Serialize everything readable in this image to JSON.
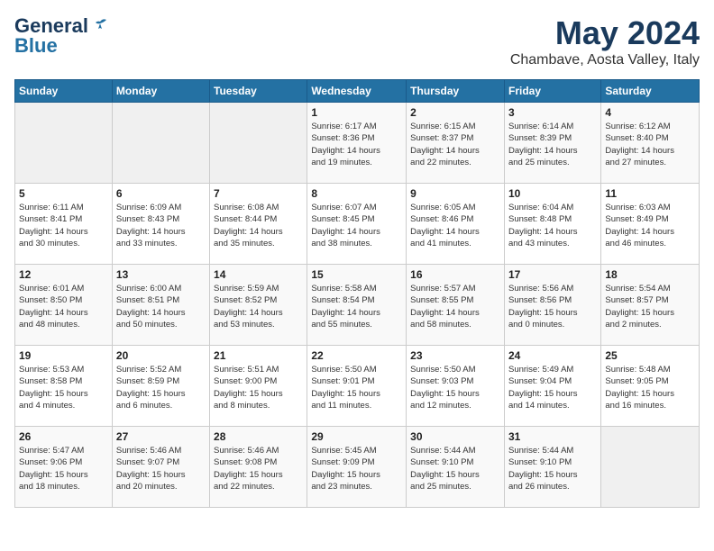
{
  "logo": {
    "line1": "General",
    "line2": "Blue"
  },
  "title": "May 2024",
  "location": "Chambave, Aosta Valley, Italy",
  "days_of_week": [
    "Sunday",
    "Monday",
    "Tuesday",
    "Wednesday",
    "Thursday",
    "Friday",
    "Saturday"
  ],
  "weeks": [
    [
      {
        "day": "",
        "info": ""
      },
      {
        "day": "",
        "info": ""
      },
      {
        "day": "",
        "info": ""
      },
      {
        "day": "1",
        "info": "Sunrise: 6:17 AM\nSunset: 8:36 PM\nDaylight: 14 hours\nand 19 minutes."
      },
      {
        "day": "2",
        "info": "Sunrise: 6:15 AM\nSunset: 8:37 PM\nDaylight: 14 hours\nand 22 minutes."
      },
      {
        "day": "3",
        "info": "Sunrise: 6:14 AM\nSunset: 8:39 PM\nDaylight: 14 hours\nand 25 minutes."
      },
      {
        "day": "4",
        "info": "Sunrise: 6:12 AM\nSunset: 8:40 PM\nDaylight: 14 hours\nand 27 minutes."
      }
    ],
    [
      {
        "day": "5",
        "info": "Sunrise: 6:11 AM\nSunset: 8:41 PM\nDaylight: 14 hours\nand 30 minutes."
      },
      {
        "day": "6",
        "info": "Sunrise: 6:09 AM\nSunset: 8:43 PM\nDaylight: 14 hours\nand 33 minutes."
      },
      {
        "day": "7",
        "info": "Sunrise: 6:08 AM\nSunset: 8:44 PM\nDaylight: 14 hours\nand 35 minutes."
      },
      {
        "day": "8",
        "info": "Sunrise: 6:07 AM\nSunset: 8:45 PM\nDaylight: 14 hours\nand 38 minutes."
      },
      {
        "day": "9",
        "info": "Sunrise: 6:05 AM\nSunset: 8:46 PM\nDaylight: 14 hours\nand 41 minutes."
      },
      {
        "day": "10",
        "info": "Sunrise: 6:04 AM\nSunset: 8:48 PM\nDaylight: 14 hours\nand 43 minutes."
      },
      {
        "day": "11",
        "info": "Sunrise: 6:03 AM\nSunset: 8:49 PM\nDaylight: 14 hours\nand 46 minutes."
      }
    ],
    [
      {
        "day": "12",
        "info": "Sunrise: 6:01 AM\nSunset: 8:50 PM\nDaylight: 14 hours\nand 48 minutes."
      },
      {
        "day": "13",
        "info": "Sunrise: 6:00 AM\nSunset: 8:51 PM\nDaylight: 14 hours\nand 50 minutes."
      },
      {
        "day": "14",
        "info": "Sunrise: 5:59 AM\nSunset: 8:52 PM\nDaylight: 14 hours\nand 53 minutes."
      },
      {
        "day": "15",
        "info": "Sunrise: 5:58 AM\nSunset: 8:54 PM\nDaylight: 14 hours\nand 55 minutes."
      },
      {
        "day": "16",
        "info": "Sunrise: 5:57 AM\nSunset: 8:55 PM\nDaylight: 14 hours\nand 58 minutes."
      },
      {
        "day": "17",
        "info": "Sunrise: 5:56 AM\nSunset: 8:56 PM\nDaylight: 15 hours\nand 0 minutes."
      },
      {
        "day": "18",
        "info": "Sunrise: 5:54 AM\nSunset: 8:57 PM\nDaylight: 15 hours\nand 2 minutes."
      }
    ],
    [
      {
        "day": "19",
        "info": "Sunrise: 5:53 AM\nSunset: 8:58 PM\nDaylight: 15 hours\nand 4 minutes."
      },
      {
        "day": "20",
        "info": "Sunrise: 5:52 AM\nSunset: 8:59 PM\nDaylight: 15 hours\nand 6 minutes."
      },
      {
        "day": "21",
        "info": "Sunrise: 5:51 AM\nSunset: 9:00 PM\nDaylight: 15 hours\nand 8 minutes."
      },
      {
        "day": "22",
        "info": "Sunrise: 5:50 AM\nSunset: 9:01 PM\nDaylight: 15 hours\nand 11 minutes."
      },
      {
        "day": "23",
        "info": "Sunrise: 5:50 AM\nSunset: 9:03 PM\nDaylight: 15 hours\nand 12 minutes."
      },
      {
        "day": "24",
        "info": "Sunrise: 5:49 AM\nSunset: 9:04 PM\nDaylight: 15 hours\nand 14 minutes."
      },
      {
        "day": "25",
        "info": "Sunrise: 5:48 AM\nSunset: 9:05 PM\nDaylight: 15 hours\nand 16 minutes."
      }
    ],
    [
      {
        "day": "26",
        "info": "Sunrise: 5:47 AM\nSunset: 9:06 PM\nDaylight: 15 hours\nand 18 minutes."
      },
      {
        "day": "27",
        "info": "Sunrise: 5:46 AM\nSunset: 9:07 PM\nDaylight: 15 hours\nand 20 minutes."
      },
      {
        "day": "28",
        "info": "Sunrise: 5:46 AM\nSunset: 9:08 PM\nDaylight: 15 hours\nand 22 minutes."
      },
      {
        "day": "29",
        "info": "Sunrise: 5:45 AM\nSunset: 9:09 PM\nDaylight: 15 hours\nand 23 minutes."
      },
      {
        "day": "30",
        "info": "Sunrise: 5:44 AM\nSunset: 9:10 PM\nDaylight: 15 hours\nand 25 minutes."
      },
      {
        "day": "31",
        "info": "Sunrise: 5:44 AM\nSunset: 9:10 PM\nDaylight: 15 hours\nand 26 minutes."
      },
      {
        "day": "",
        "info": ""
      }
    ]
  ]
}
